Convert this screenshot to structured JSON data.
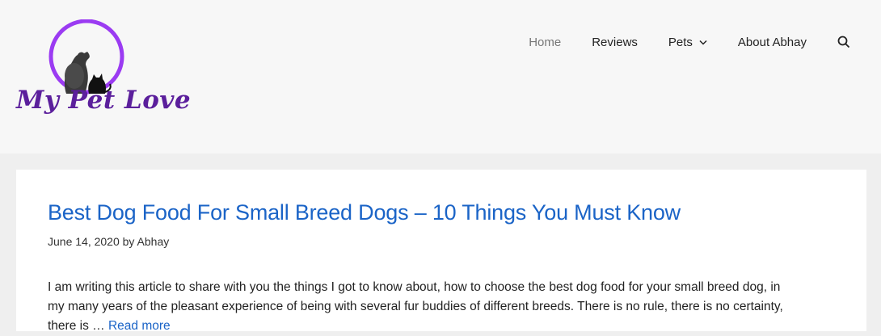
{
  "brand": {
    "logo_text": "My Pet Love",
    "accent": "#9b3bf2",
    "text_color": "#5b1f9c"
  },
  "nav": {
    "items": [
      {
        "label": "Home",
        "active": true
      },
      {
        "label": "Reviews",
        "active": false
      },
      {
        "label": "Pets",
        "active": false,
        "has_dropdown": true
      },
      {
        "label": "About Abhay",
        "active": false
      }
    ],
    "search_icon": "search-icon"
  },
  "post": {
    "title": "Best Dog Food For Small Breed Dogs – 10 Things You Must Know",
    "date": "June 14, 2020",
    "by": "by",
    "author": "Abhay",
    "excerpt_line1": "I am writing this article to share with you the things I got to know about, how to choose the best dog food for your small breed dog, in",
    "excerpt_line2": "my many years of the pleasant experience of being with several fur buddies of different breeds. There is no rule, there is no certainty,",
    "excerpt_line3": "there is …",
    "read_more": "Read more"
  },
  "colors": {
    "link": "#1b64c7",
    "page_bg": "#efefef",
    "header_bg": "#f7f7f7"
  }
}
